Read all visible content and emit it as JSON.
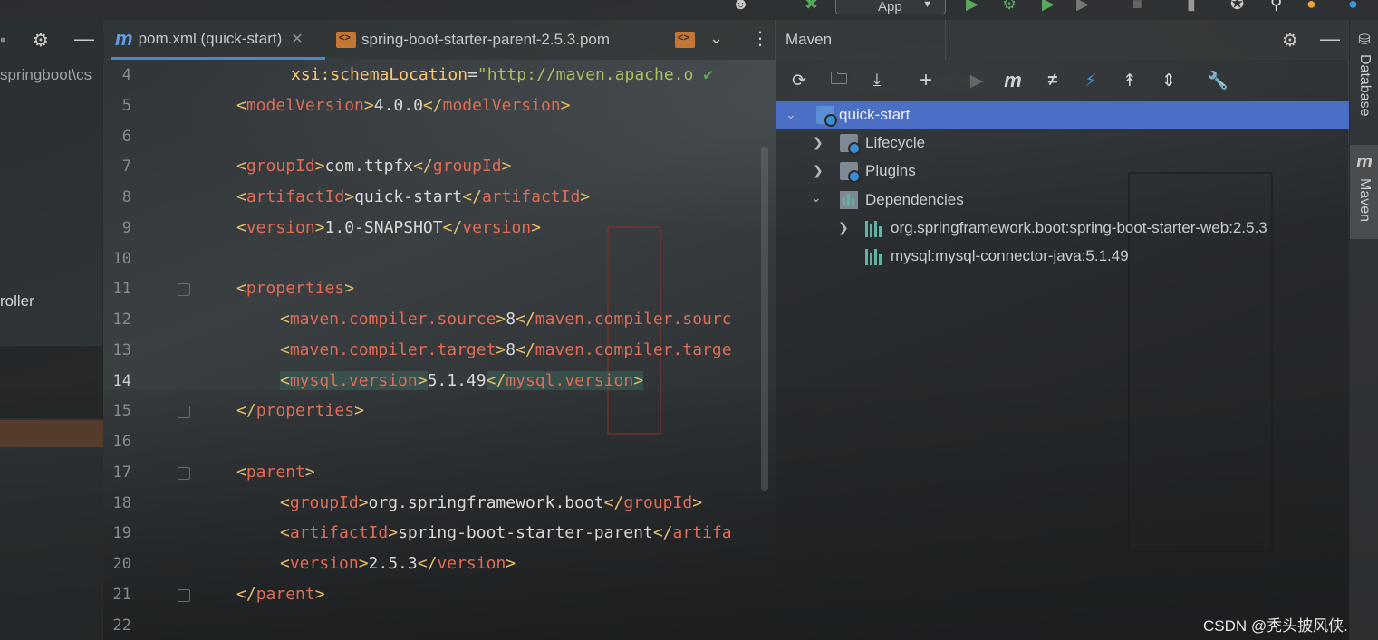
{
  "toolbar": {
    "run_config": "App"
  },
  "project": {
    "path_fragment": "springboot\\cs",
    "item_fragment": "roller"
  },
  "editor": {
    "tabs": [
      {
        "label": "pom.xml (quick-start)",
        "active": true
      },
      {
        "label": "spring-boot-starter-parent-2.5.3.pom",
        "active": false
      },
      {
        "label": "",
        "active": false
      }
    ],
    "line_numbers": [
      "4",
      "5",
      "6",
      "7",
      "8",
      "9",
      "10",
      "11",
      "12",
      "13",
      "14",
      "15",
      "16",
      "17",
      "18",
      "19",
      "20",
      "21",
      "22"
    ],
    "lines": {
      "l4_attr": "xsi:schemaLocation",
      "l4_eq": "=",
      "l4_str": "\"http://maven.apache.o",
      "l5_open": "modelVersion",
      "l5_val": "4.0.0",
      "l7_open": "groupId",
      "l7_val": "com.ttpfx",
      "l8_open": "artifactId",
      "l8_val": "quick-start",
      "l9_open": "version",
      "l9_val": "1.0-SNAPSHOT",
      "l11_open": "properties",
      "l12_open": "maven.compiler.source",
      "l12_val": "8",
      "l12_close": "maven.compiler.sourc",
      "l13_open": "maven.compiler.target",
      "l13_val": "8",
      "l13_close": "maven.compiler.targe",
      "l14_open": "mysql.version",
      "l14_val": "5.1.49",
      "l15_close": "properties",
      "l17_open": "parent",
      "l18_open": "groupId",
      "l18_val": "org.springframework.boot",
      "l19_open": "artifactId",
      "l19_val": "spring-boot-starter-parent",
      "l19_close": "artifa",
      "l20_open": "version",
      "l20_val": "2.5.3",
      "l21_close": "parent"
    }
  },
  "maven": {
    "title": "Maven",
    "tree": [
      {
        "label": "quick-start",
        "selected": true
      },
      {
        "label": "Lifecycle"
      },
      {
        "label": "Plugins"
      },
      {
        "label": "Dependencies"
      },
      {
        "label": "org.springframework.boot:spring-boot-starter-web:2.5.3"
      },
      {
        "label": "mysql:mysql-connector-java:5.1.49"
      }
    ]
  },
  "right_strip": {
    "tabs": [
      "Database",
      "Maven"
    ]
  },
  "watermark": "CSDN @秃头披风侠.",
  "colors": {
    "selection": "#4b6fc4",
    "tag_name": "#e06c55",
    "bracket": "#e8bf6a",
    "string": "#a5c25c",
    "accent_tab": "#4a88c7"
  }
}
